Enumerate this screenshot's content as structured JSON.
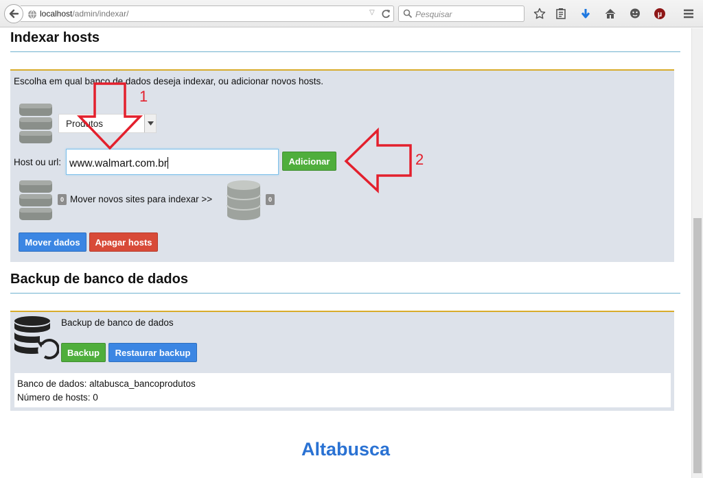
{
  "browser": {
    "url_host": "localhost",
    "url_path": "/admin/indexar/",
    "search_placeholder": "Pesquisar"
  },
  "indexar": {
    "title": "Indexar hosts",
    "intro": "Escolha em qual banco de dados deseja indexar, ou adicionar novos hosts.",
    "db_select_value": "Produtos",
    "host_label": "Host ou url:",
    "host_value": "www.walmart.com.br",
    "add_button": "Adicionar",
    "new_sites_count": "0",
    "move_label": "Mover novos sites para indexar >>",
    "indexed_count": "0",
    "move_button": "Mover dados",
    "delete_button": "Apagar hosts"
  },
  "backup": {
    "title": "Backup de banco de dados",
    "panel_heading": "Backup de banco de dados",
    "backup_button": "Backup",
    "restore_button": "Restaurar backup",
    "db_line": "Banco de dados: altabusca_bancoprodutos",
    "hosts_line": "Número de hosts: 0"
  },
  "annotations": {
    "step1": "1",
    "step2": "2"
  },
  "footer": {
    "brand": "Altabusca"
  },
  "colors": {
    "accent_blue": "#2a72d3",
    "panel_bg": "#dde2ea",
    "panel_top_border": "#d8ac2b",
    "annotation_red": "#e3202d"
  }
}
